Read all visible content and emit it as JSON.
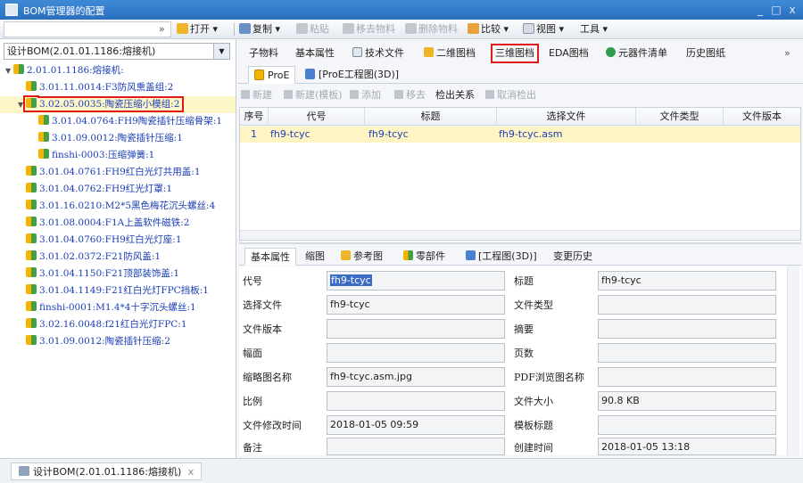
{
  "window": {
    "title": "BOM管理器的配置",
    "min_glyph": "_",
    "max_glyph": "□",
    "close_glyph": "x"
  },
  "toolbar": {
    "open": "打开",
    "copy": "复制",
    "paste": "粘贴",
    "remove_material": "移去物料",
    "delete_material": "删除物料",
    "compare": "比较",
    "view": "视图",
    "tools": "工具",
    "chevron": "»"
  },
  "left_panel": {
    "bom_select": "设计BOM(2.01.01.1186:熔接机)",
    "tree": [
      {
        "label": "2.01.01.1186:熔接机:",
        "level": 0,
        "toggle": "▼",
        "selected": false,
        "highlight": false
      },
      {
        "label": "3.01.11.0014:F3防风熏盖组:2",
        "level": 1,
        "toggle": "",
        "selected": false,
        "highlight": false
      },
      {
        "label": "3.02.05.0035:陶瓷压缩小模组:2",
        "level": 1,
        "toggle": "▼",
        "selected": true,
        "highlight": true
      },
      {
        "label": "3.01.04.0764:FH9陶瓷插针压缩骨架:1",
        "level": 2,
        "toggle": "",
        "selected": false,
        "highlight": false
      },
      {
        "label": "3.01.09.0012:陶瓷插针压缩:1",
        "level": 2,
        "toggle": "",
        "selected": false,
        "highlight": false
      },
      {
        "label": "finshi-0003:压缩弹簧:1",
        "level": 2,
        "toggle": "",
        "selected": false,
        "highlight": false
      },
      {
        "label": "3.01.04.0761:FH9红白光灯共用盖:1",
        "level": 1,
        "toggle": "",
        "selected": false,
        "highlight": false
      },
      {
        "label": "3.01.04.0762:FH9红光灯罩:1",
        "level": 1,
        "toggle": "",
        "selected": false,
        "highlight": false
      },
      {
        "label": "3.01.16.0210:M2*5黑色梅花沉头螺丝:4",
        "level": 1,
        "toggle": "",
        "selected": false,
        "highlight": false
      },
      {
        "label": "3.01.08.0004:F1A上盖软件磁铁:2",
        "level": 1,
        "toggle": "",
        "selected": false,
        "highlight": false
      },
      {
        "label": "3.01.04.0760:FH9红白光灯座:1",
        "level": 1,
        "toggle": "",
        "selected": false,
        "highlight": false
      },
      {
        "label": "3.01.02.0372:F21防风盖:1",
        "level": 1,
        "toggle": "",
        "selected": false,
        "highlight": false
      },
      {
        "label": "3.01.04.1150:F21顶部装饰盖:1",
        "level": 1,
        "toggle": "",
        "selected": false,
        "highlight": false
      },
      {
        "label": "3.01.04.1149:F21红白光灯FPC挡板:1",
        "level": 1,
        "toggle": "",
        "selected": false,
        "highlight": false
      },
      {
        "label": "finshi-0001:M1.4*4十字沉头螺丝:1",
        "level": 1,
        "toggle": "",
        "selected": false,
        "highlight": false
      },
      {
        "label": "3.02.16.0048:f21红白光灯FPC:1",
        "level": 1,
        "toggle": "",
        "selected": false,
        "highlight": false
      },
      {
        "label": "3.01.09.0012:陶瓷插针压缩:2",
        "level": 1,
        "toggle": "",
        "selected": false,
        "highlight": false
      }
    ]
  },
  "tabs": {
    "sub_material": "子物料",
    "basic_props": "基本属性",
    "tech_doc": "技术文件",
    "drawing_2d": "二维图档",
    "drawing_3d": "三维图档",
    "eda": "EDA图档",
    "component_list": "元器件清单",
    "history": "历史图纸",
    "more": "»"
  },
  "subtabs": {
    "proe": "ProE",
    "proe_eng": "[ProE工程图(3D)]"
  },
  "actions": {
    "new": "新建",
    "new_template": "新建(模板)",
    "add": "添加",
    "remove": "移去",
    "checkout_rel": "检出关系",
    "cancel_checkout": "取消检出"
  },
  "grid": {
    "columns": [
      "序号",
      "代号",
      "标题",
      "选择文件",
      "文件类型",
      "文件版本"
    ],
    "rows": [
      {
        "no": "1",
        "code": "fh9-tcyc",
        "title": "fh9-tcyc",
        "file": "fh9-tcyc.asm",
        "type": "",
        "version": ""
      }
    ]
  },
  "bottom_tabs": {
    "basic": "基本属性",
    "thumb": "缩图",
    "ref": "参考图",
    "parts": "零部件",
    "eng": "[工程图(3D)]",
    "changes": "变更历史"
  },
  "form": {
    "labels": {
      "code": "代号",
      "title": "标题",
      "select_file": "选择文件",
      "file_type": "文件类型",
      "file_version": "文件版本",
      "summary": "摘要",
      "sheet": "幅面",
      "pages": "页数",
      "thumb_name": "缩略图名称",
      "pdf_name": "PDF浏览图名称",
      "scale": "比例",
      "file_size": "文件大小",
      "modified": "文件修改时间",
      "template_title": "模板标题",
      "remark": "备注",
      "created": "创建时间"
    },
    "values": {
      "code": "fh9-tcyc",
      "title": "fh9-tcyc",
      "select_file": "fh9-tcyc",
      "file_type": "",
      "file_version": "",
      "summary": "",
      "sheet": "",
      "pages": "",
      "thumb_name": "fh9-tcyc.asm.jpg",
      "pdf_name": "",
      "scale": "",
      "file_size": "90.8 KB",
      "modified": "2018-01-05 09:59",
      "template_title": "",
      "remark": "",
      "created": "2018-01-05 13:18"
    }
  },
  "status": {
    "tab": "设计BOM(2.01.01.1186:熔接机)",
    "close": "x"
  },
  "colors": {
    "title_bar": "#2a6fbe",
    "selected_row": "#fff4c3",
    "highlight_border": "#e01919",
    "tree_text": "#1a3db5"
  }
}
